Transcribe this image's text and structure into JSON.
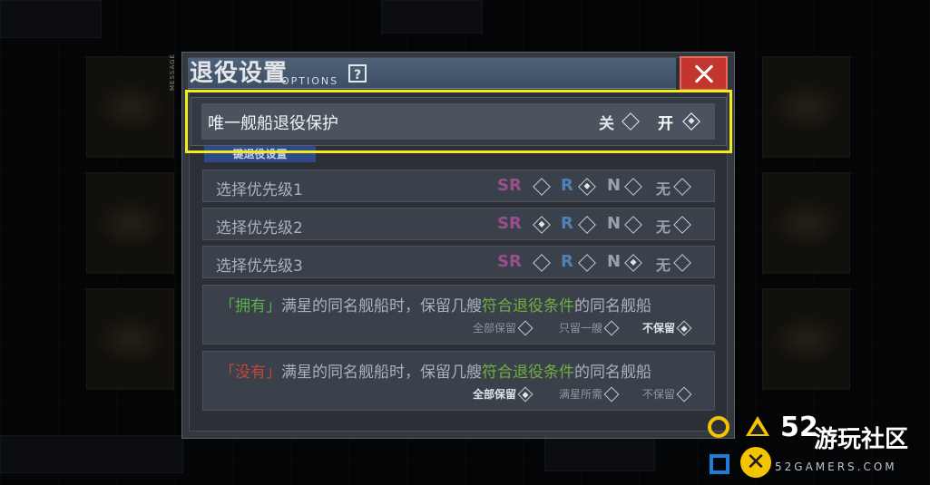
{
  "dialog": {
    "title": "退役设置",
    "title_sub": "OPTIONS",
    "help_label": "?",
    "side_caption": "MESSAGE"
  },
  "unique_protect": {
    "label": "唯一舰船退役保护",
    "off_label": "关",
    "on_label": "开",
    "selected": "开"
  },
  "subtab_label": "键退役设置",
  "priorities": [
    {
      "label": "选择优先级1",
      "options": [
        "SR",
        "R",
        "N",
        "无"
      ],
      "selected": "R"
    },
    {
      "label": "选择优先级2",
      "options": [
        "SR",
        "R",
        "N",
        "无"
      ],
      "selected": "SR"
    },
    {
      "label": "选择优先级3",
      "options": [
        "SR",
        "R",
        "N",
        "无"
      ],
      "selected": "N"
    }
  ],
  "rarity_colors": {
    "SR": "#9a4f8c",
    "R": "#4d82b8",
    "N": "#9aa1a9",
    "无": "#9aa1a9"
  },
  "keep_have": {
    "prefix": "「拥有」",
    "middle": "满星的同名舰船时，保留几艘",
    "highlight": "符合退役条件",
    "suffix": "的同名舰船",
    "prefix_color": "#57b04a",
    "options": [
      "全部保留",
      "只留一艘",
      "不保留"
    ],
    "selected": "不保留"
  },
  "keep_none": {
    "prefix": "「没有」",
    "middle": "满星的同名舰船时，保留几艘",
    "highlight": "符合退役条件",
    "suffix": "的同名舰船",
    "prefix_color": "#c4443e",
    "options": [
      "全部保留",
      "满星所需",
      "不保留"
    ],
    "selected": "全部保留"
  },
  "watermark": {
    "number": "52",
    "name": "游玩社区",
    "url": "52GAMERS.COM"
  }
}
